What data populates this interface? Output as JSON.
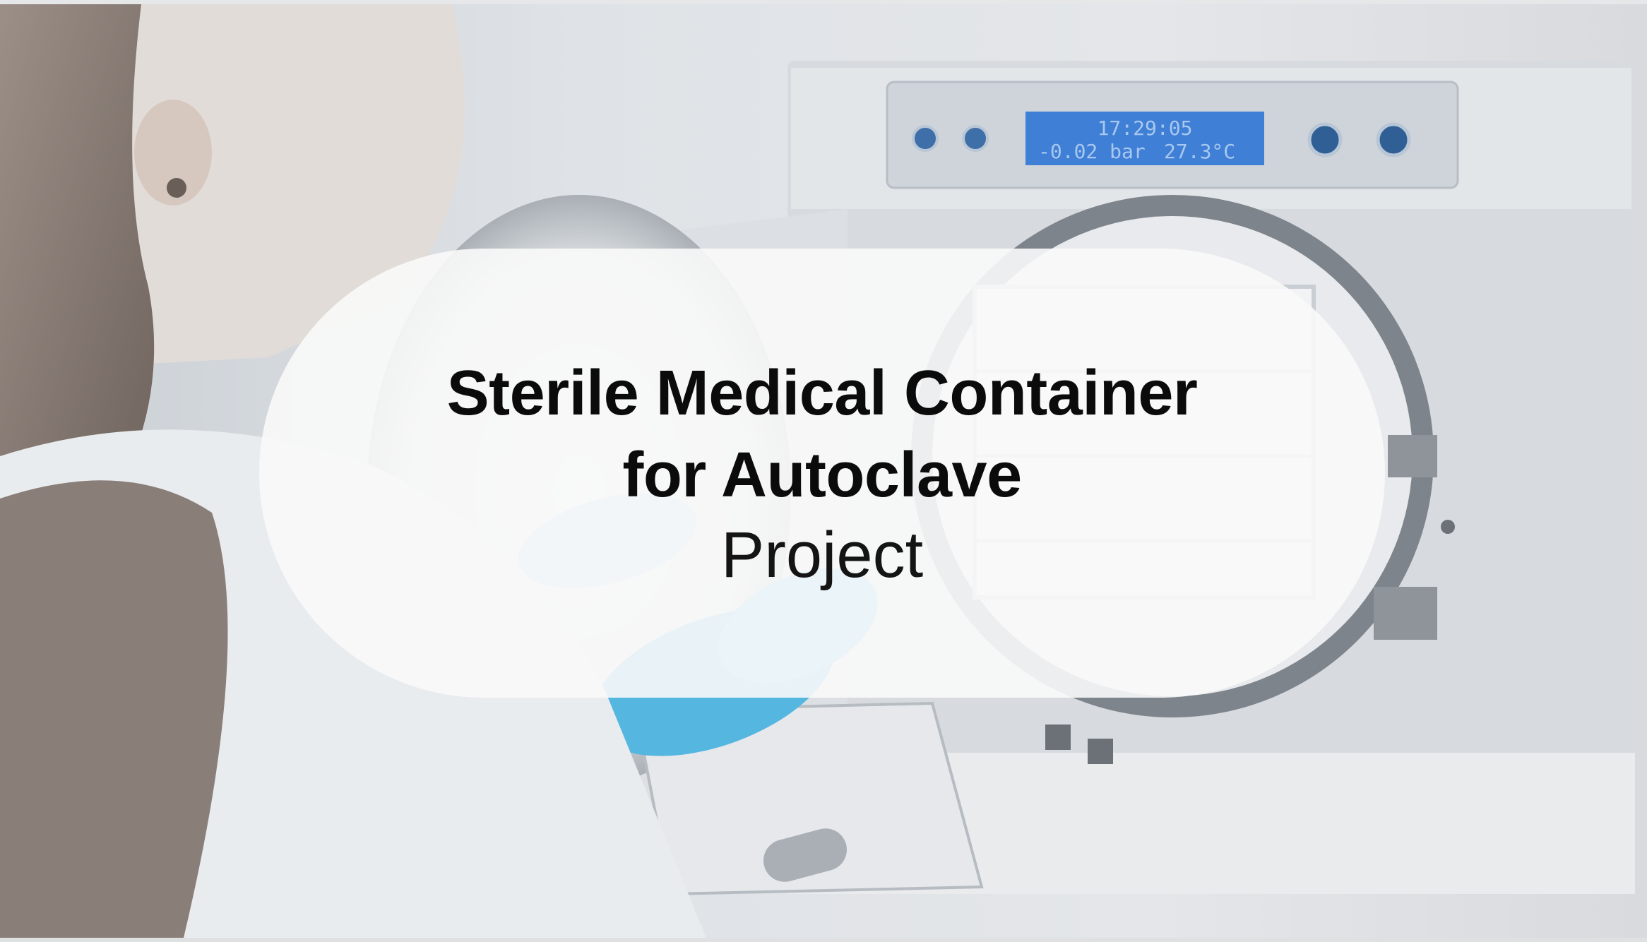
{
  "banner": {
    "title_line_1": "Sterile Medical Container",
    "title_line_2": "for Autoclave",
    "subtitle": "Project"
  },
  "autoclave_display": {
    "time": "17:29:05",
    "pressure": "-0.02 bar",
    "temperature": "27.3°C"
  },
  "colors": {
    "overlay_pill": "#fafafa",
    "title_text": "#0b0b0b",
    "lcd_screen": "#3f7fd6",
    "glove": "#55b6e0"
  }
}
